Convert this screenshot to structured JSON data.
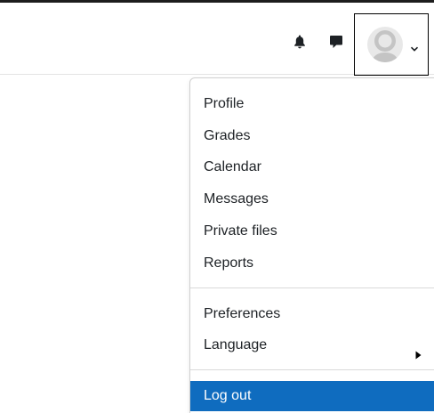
{
  "navbar": {
    "notifications_icon": "bell-icon",
    "messages_icon": "speech-bubble-icon",
    "user_menu": {
      "avatar_icon": "user-avatar-icon",
      "toggle_icon": "chevron-down-icon"
    }
  },
  "user_menu_dropdown": {
    "items": [
      {
        "label": "Profile"
      },
      {
        "label": "Grades"
      },
      {
        "label": "Calendar"
      },
      {
        "label": "Messages"
      },
      {
        "label": "Private files"
      },
      {
        "label": "Reports"
      }
    ],
    "settings_items": [
      {
        "label": "Preferences"
      },
      {
        "label": "Language",
        "submenu_icon": "caret-right-icon"
      }
    ],
    "logout": {
      "label": "Log out",
      "highlight_color": "#0f6cbf"
    }
  },
  "colors": {
    "accent": "#0f6cbf",
    "icon": "#1d2125",
    "avatar_bg": "#e8e8e8",
    "avatar_fg": "#c4c4c4"
  }
}
